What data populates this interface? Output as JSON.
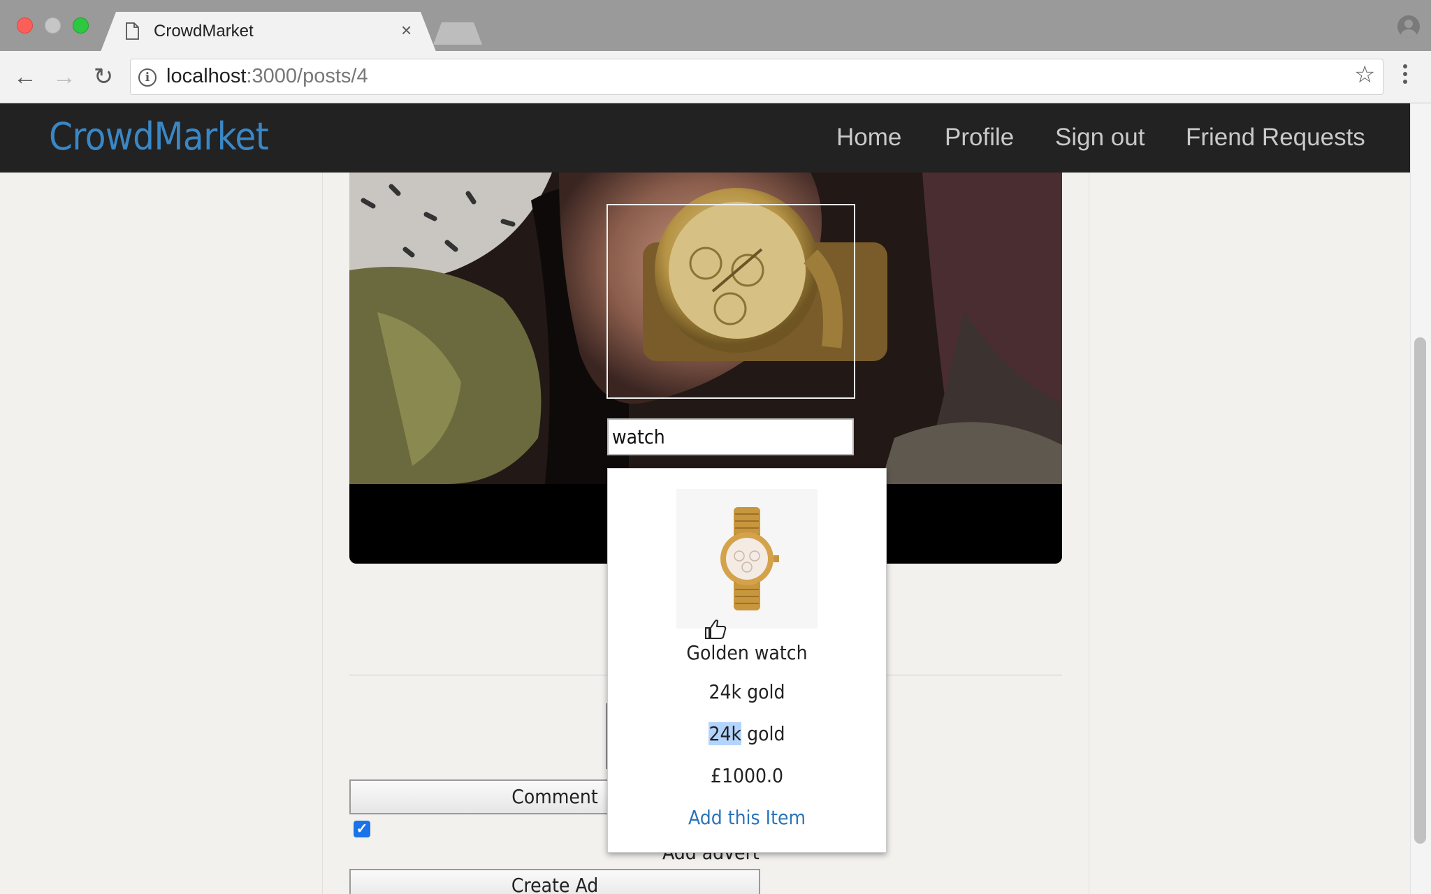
{
  "browser": {
    "tab_title": "CrowdMarket",
    "tab_close": "×",
    "url_host": "localhost",
    "url_path": ":3000/posts/4"
  },
  "navbar": {
    "brand": "CrowdMarket",
    "links": [
      "Home",
      "Profile",
      "Sign out",
      "Friend Requests"
    ]
  },
  "tag_input": {
    "value": "watch"
  },
  "suggestion": {
    "name": "Golden watch",
    "description_1": "24k gold",
    "description_2_highlight": "24k",
    "description_2_rest": " gold",
    "price": "£1000.0",
    "add_link": "Add this Item"
  },
  "form": {
    "comment_button": "Comment",
    "add_advert_label": "Add advert",
    "create_ad_button": "Create Ad",
    "advert_checked": true
  },
  "colors": {
    "brand": "#3a87c6",
    "navbar_bg": "#222222",
    "link": "#2a75bb",
    "page_bg": "#f3f1ee"
  }
}
